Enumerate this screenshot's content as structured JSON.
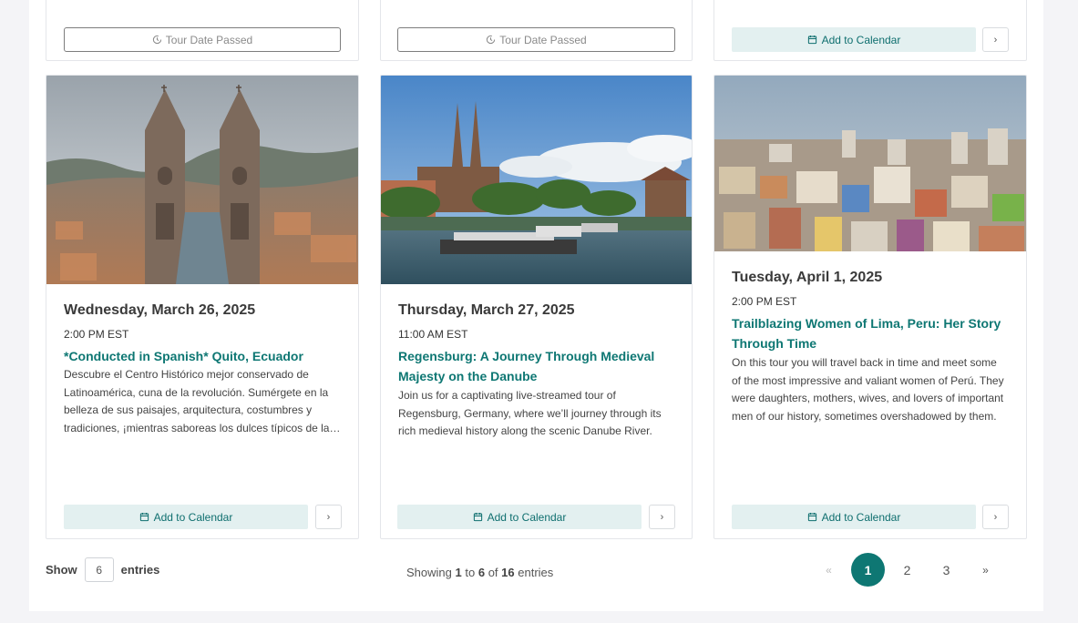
{
  "top_row": [
    {
      "button": "Tour Date Passed"
    },
    {
      "button": "Tour Date Passed"
    },
    {
      "button": "Add to Calendar",
      "more": "›"
    }
  ],
  "cards": [
    {
      "date": "Wednesday, March 26, 2025",
      "time": "2:00 PM EST",
      "title": "*Conducted in Spanish* Quito, Ecuador",
      "description": "Descubre el Centro Histórico mejor conservado de Latinoamérica, cuna de la revolución. Sumérgete en la belleza de sus paisajes, arquitectura, costumbres y tradiciones, ¡mientras saboreas los dulces típicos de la ciudad!",
      "button": "Add to Calendar",
      "more": "›"
    },
    {
      "date": "Thursday, March 27, 2025",
      "time": "11:00 AM EST",
      "title": "Regensburg: A Journey Through Medieval Majesty on the Danube",
      "description": "Join us for a captivating live-streamed tour of Regensburg, Germany, where we’ll journey through its rich medieval history along the scenic Danube River.",
      "button": "Add to Calendar",
      "more": "›"
    },
    {
      "date": "Tuesday, April 1, 2025",
      "time": "2:00 PM EST",
      "title": "Trailblazing Women of Lima, Peru: Her Story Through Time",
      "description": "On this tour you will travel back in time and meet some of the most impressive and valiant women of Perú. They were daughters, mothers, wives, and lovers of important men of our history, sometimes overshadowed by them.",
      "button": "Add to Calendar",
      "more": "›"
    }
  ],
  "footer": {
    "show_label": "Show",
    "entries_value": "6",
    "entries_label": "entries",
    "info_prefix": "Showing",
    "info_from": "1",
    "info_to_word": "to",
    "info_to": "6",
    "info_of_word": "of",
    "info_total": "16",
    "info_suffix": "entries"
  },
  "pagination": {
    "prev": "«",
    "pages": [
      "1",
      "2",
      "3"
    ],
    "active": "1",
    "next": "»"
  },
  "colors": {
    "accent": "#0e7773",
    "button_bg": "#e3f0f0",
    "page_bg": "#f4f4f7"
  },
  "icons": {
    "passed": "clock-history-icon",
    "calendar": "calendar-icon",
    "more": "chevron-right-icon"
  }
}
